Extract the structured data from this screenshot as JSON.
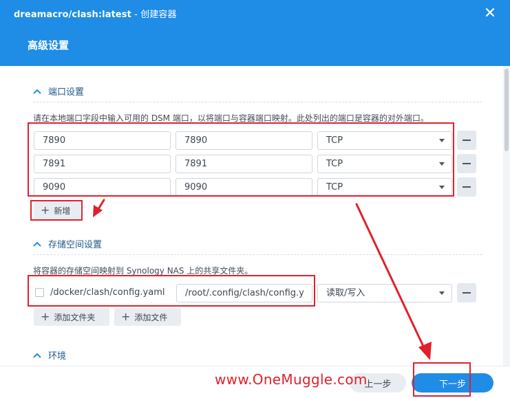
{
  "window": {
    "title": "dreamacro/clash:latest",
    "title_suffix": " - 创建容器",
    "subtitle": "高级设置",
    "close_icon": "close-icon",
    "header_color": "#1f8ce6"
  },
  "port_section": {
    "heading": "端口设置",
    "description": "请在本地端口字段中输入可用的 DSM 端口，以将端口与容器端口映射。此处列出的端口是容器的对外端口。",
    "rows": [
      {
        "local": "7890",
        "container": "7890",
        "protocol": "TCP"
      },
      {
        "local": "7891",
        "container": "7891",
        "protocol": "TCP"
      },
      {
        "local": "9090",
        "container": "9090",
        "protocol": "TCP"
      }
    ],
    "add_label": "新增"
  },
  "storage_section": {
    "heading": "存储空间设置",
    "description": "将容器的存储空间映射到 Synology NAS 上的共享文件夹。",
    "row": {
      "host_path": "/docker/clash/config.yaml",
      "mount_path": "/root/.config/clash/config.y",
      "permission": "读取/写入"
    },
    "add_folder_label": "添加文件夹",
    "add_file_label": "添加文件"
  },
  "env_section": {
    "heading": "环境"
  },
  "footer": {
    "prev_label": "上一步",
    "next_label": "下一步"
  },
  "watermark": "www.OneMuggle.com",
  "annotation_color": "#e0202b"
}
